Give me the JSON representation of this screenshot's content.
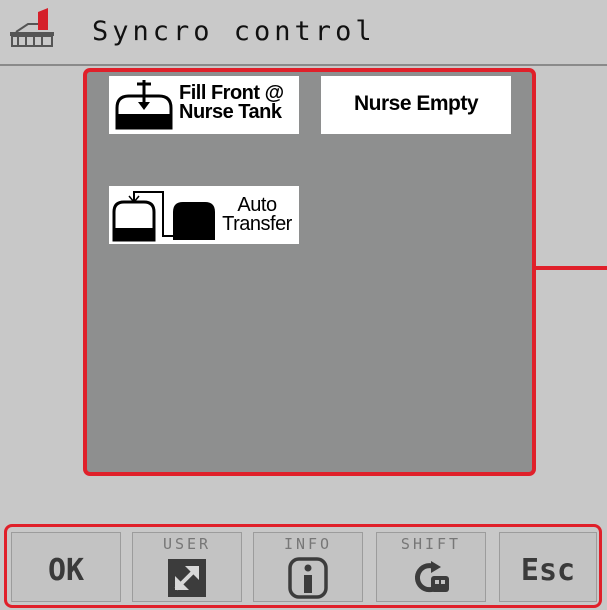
{
  "header": {
    "title": "Syncro control",
    "logo_icon": "sprayer-logo-icon"
  },
  "functions": {
    "fill_front": {
      "line1": "Fill Front @",
      "line2": "Nurse Tank",
      "icon": "tank-fill-icon"
    },
    "nurse_empty": {
      "label": "Nurse Empty"
    },
    "auto_transfer": {
      "line1": "Auto",
      "line2": "Transfer",
      "icon": "tank-transfer-icon"
    }
  },
  "softkeys": {
    "ok": {
      "label": "OK"
    },
    "user": {
      "caption": "USER",
      "icon": "expand-arrow-icon"
    },
    "info": {
      "caption": "INFO",
      "icon": "info-icon"
    },
    "shift": {
      "caption": "SHIFT",
      "icon": "shift-cycle-icon"
    },
    "esc": {
      "label": "Esc"
    }
  },
  "colors": {
    "highlight_border": "#e0202a",
    "panel_bg": "#8e8f8f",
    "screen_bg": "#c8c8c8"
  }
}
